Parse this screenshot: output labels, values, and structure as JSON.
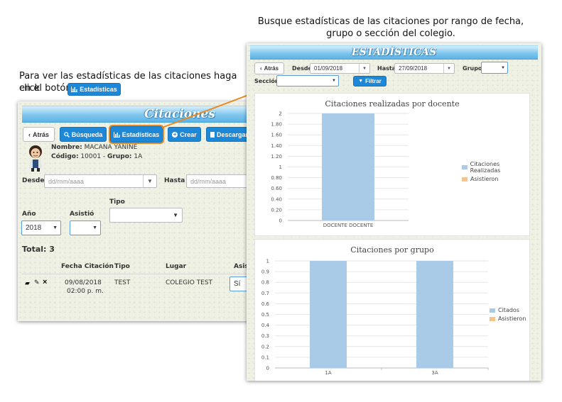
{
  "captions": {
    "top_right": "Busque estadísticas de las citaciones por rango de fecha, grupo o sección del colegio.",
    "left_line1": "Para ver las estadísticas de las citaciones haga click",
    "left_line2": "en el botón",
    "inline_button": "Estadísticas"
  },
  "left_panel": {
    "title": "Citaciones",
    "toolbar": {
      "back": "Atrás",
      "search": "Búsqueda",
      "stats": "Estadísticas",
      "create": "Crear",
      "download": "Descargar"
    },
    "profile": {
      "name_label": "Nombre:",
      "name_value": "MACANA YANINE",
      "code_label": "Código:",
      "code_value": "10001",
      "group_label": "Grupo:",
      "group_value": "1A"
    },
    "filters": {
      "desde_label": "Desde",
      "desde_placeholder": "dd/mm/aaaa",
      "hasta_label": "Hasta",
      "hasta_placeholder": "dd/mm/aaaa",
      "tipo_label": "Tipo",
      "anio_label": "Año",
      "anio_value": "2018",
      "asistio_label": "Asistió"
    },
    "total": "Total: 3",
    "table": {
      "headers": [
        "Fecha Citación",
        "Tipo",
        "Lugar",
        "Asis"
      ],
      "rows": [
        {
          "date": "09/08/2018",
          "time": "02:00 p. m.",
          "tipo": "TEST",
          "lugar": "COLEGIO TEST",
          "asistio": "Sí"
        }
      ]
    }
  },
  "right_panel": {
    "title": "ESTADÍSTICAS",
    "back": "Atrás",
    "desde_label": "Desde",
    "desde_value": "01/09/2018",
    "hasta_label": "Hasta",
    "hasta_value": "27/09/2018",
    "grupo_label": "Grupo",
    "seccion_label": "Sección",
    "filter_button": "Filtrar"
  },
  "chart_data": [
    {
      "type": "bar",
      "title": "Citaciones realizadas por docente",
      "categories": [
        "DOCENTE DOCENTE"
      ],
      "series": [
        {
          "name": "Citaciones Realizadas",
          "values": [
            2
          ]
        },
        {
          "name": "Asistieron",
          "values": [
            0
          ]
        }
      ],
      "yticks": [
        "0",
        "0.20",
        "0.40",
        "0.60",
        "0.80",
        "1",
        "1.20",
        "1.40",
        "1.60",
        "1.80",
        "2"
      ],
      "ylim": [
        0,
        2
      ],
      "legend": "right",
      "colors": [
        "#a9cbe8",
        "#f6c48a"
      ]
    },
    {
      "type": "bar",
      "title": "Citaciones por grupo",
      "categories": [
        "1A",
        "3A"
      ],
      "series": [
        {
          "name": "Citados",
          "values": [
            1,
            1
          ]
        },
        {
          "name": "Asistieron",
          "values": [
            0,
            0
          ]
        }
      ],
      "yticks": [
        "0",
        "0.1",
        "0.2",
        "0.3",
        "0.4",
        "0.5",
        "0.6",
        "0.7",
        "0.8",
        "0.9",
        "1"
      ],
      "ylim": [
        0,
        1
      ],
      "legend": "right",
      "colors": [
        "#a9cbe8",
        "#f6c48a"
      ]
    }
  ]
}
